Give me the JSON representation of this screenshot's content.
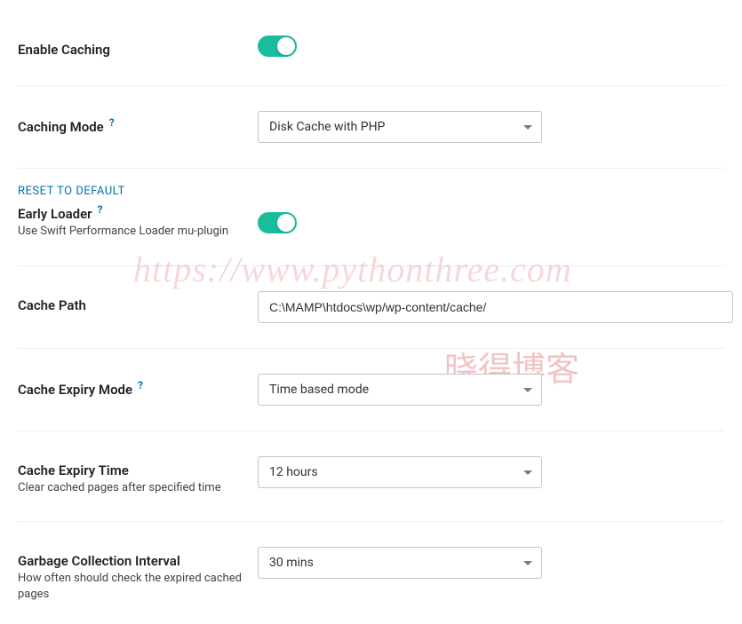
{
  "enable_caching": {
    "label": "Enable Caching",
    "value": true
  },
  "caching_mode": {
    "label": "Caching Mode",
    "selected": "Disk Cache with PHP"
  },
  "early_loader": {
    "reset_label": "RESET TO DEFAULT",
    "label": "Early Loader",
    "desc": "Use Swift Performance Loader mu-plugin",
    "value": true
  },
  "cache_path": {
    "label": "Cache Path",
    "value": "C:\\MAMP\\htdocs\\wp/wp-content/cache/"
  },
  "cache_expiry_mode": {
    "label": "Cache Expiry Mode",
    "selected": "Time based mode"
  },
  "cache_expiry_time": {
    "label": "Cache Expiry Time",
    "desc": "Clear cached pages after specified time",
    "selected": "12 hours"
  },
  "garbage_collection": {
    "label": "Garbage Collection Interval",
    "desc": "How often should check the expired cached pages",
    "selected": "30 mins"
  },
  "watermarks": {
    "url": "https://www.pythonthree.com",
    "name": "晓得博客"
  },
  "help_symbol": "?"
}
